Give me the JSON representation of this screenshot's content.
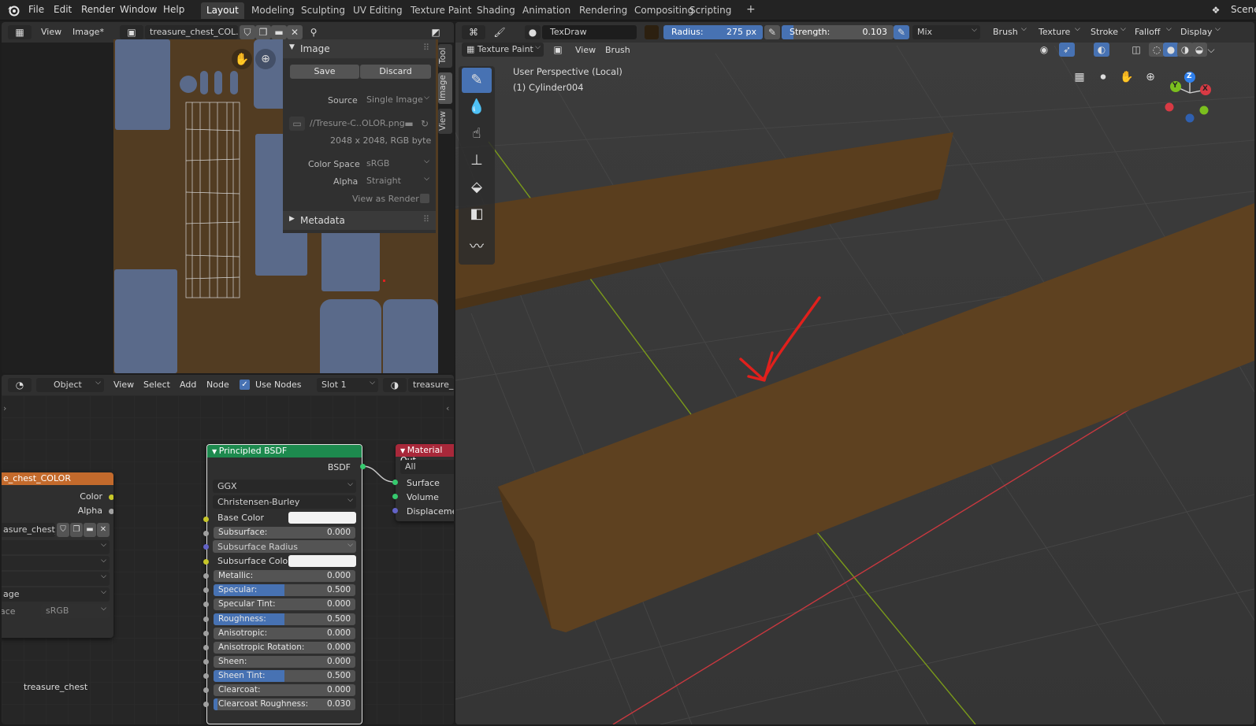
{
  "topbar": {
    "menus": [
      "File",
      "Edit",
      "Render",
      "Window",
      "Help"
    ],
    "workspaces": [
      "Layout",
      "Modeling",
      "Sculpting",
      "UV Editing",
      "Texture Paint",
      "Shading",
      "Animation",
      "Rendering",
      "Compositing",
      "Scripting"
    ],
    "active_workspace": "Layout",
    "add_tab": "+",
    "scene_label": "Scene"
  },
  "image_editor": {
    "view_menu": "View",
    "image_menu": "Image*",
    "image_name": "treasure_chest_COL..",
    "side_tabs": [
      "Tool",
      "Image",
      "View"
    ],
    "panel": {
      "title": "Image",
      "save_label": "Save",
      "discard_label": "Discard",
      "source_label": "Source",
      "source_value": "Single Image",
      "filepath": "//Tresure-C..OLOR.png",
      "resolution": "2048 x 2048,  RGB byte",
      "color_space_label": "Color Space",
      "color_space_value": "sRGB",
      "alpha_label": "Alpha",
      "alpha_value": "Straight",
      "view_as_render_label": "View as Render",
      "metadata_label": "Metadata"
    }
  },
  "node_editor": {
    "object_mode": "Object",
    "view_menu": "View",
    "select_menu": "Select",
    "add_menu": "Add",
    "node_menu": "Node",
    "use_nodes_label": "Use Nodes",
    "slot": "Slot 1",
    "material_name": "treasure_c",
    "material_footer": "treasure_chest",
    "image_node": {
      "title": "e_chest_COLOR",
      "out_color": "Color",
      "out_alpha": "Alpha",
      "image_name": "asure_chest_..",
      "row_label": "age",
      "cs_label": "ace",
      "cs_value": "sRGB"
    },
    "bsdf_node": {
      "title": "Principled BSDF",
      "output": "BSDF",
      "distribution": "GGX",
      "subsurface_method": "Christensen-Burley",
      "base_color_label": "Base Color",
      "subsurface_radius_label": "Subsurface Radius",
      "subsurface_color_label": "Subsurface Color",
      "fields": [
        {
          "label": "Subsurface:",
          "value": "0.000",
          "fraction": 0
        },
        {
          "label": "Metallic:",
          "value": "0.000",
          "fraction": 0
        },
        {
          "label": "Specular:",
          "value": "0.500",
          "fraction": 0.5
        },
        {
          "label": "Specular Tint:",
          "value": "0.000",
          "fraction": 0
        },
        {
          "label": "Roughness:",
          "value": "0.500",
          "fraction": 0.5
        },
        {
          "label": "Anisotropic:",
          "value": "0.000",
          "fraction": 0
        },
        {
          "label": "Anisotropic Rotation:",
          "value": "0.000",
          "fraction": 0
        },
        {
          "label": "Sheen:",
          "value": "0.000",
          "fraction": 0
        },
        {
          "label": "Sheen Tint:",
          "value": "0.500",
          "fraction": 0.5
        },
        {
          "label": "Clearcoat:",
          "value": "0.000",
          "fraction": 0
        },
        {
          "label": "Clearcoat Roughness:",
          "value": "0.030",
          "fraction": 0.03
        }
      ]
    },
    "output_node": {
      "title": "Material Out",
      "target": "All",
      "inputs": [
        "Surface",
        "Volume",
        "Displacemen"
      ]
    }
  },
  "viewport": {
    "brush_name": "TexDraw",
    "radius_label": "Radius:",
    "radius_value": "275 px",
    "strength_label": "Strength:",
    "strength_value": "0.103",
    "strength_fraction": 0.103,
    "blend": "Mix",
    "header_dropdowns": [
      "Brush",
      "Texture",
      "Stroke",
      "Falloff",
      "Display"
    ],
    "mode": "Texture Paint",
    "view_menu": "View",
    "brush_menu": "Brush",
    "perspective_text": "User Perspective (Local)",
    "object_text": "(1) Cylinder004",
    "gizmo_axes": [
      "X",
      "Y",
      "Z"
    ],
    "colors": {
      "wood": "#5a3e1e",
      "x_axis": "#c8383f",
      "y_axis": "#7a9a1a",
      "annotation": "#e0201c"
    }
  }
}
